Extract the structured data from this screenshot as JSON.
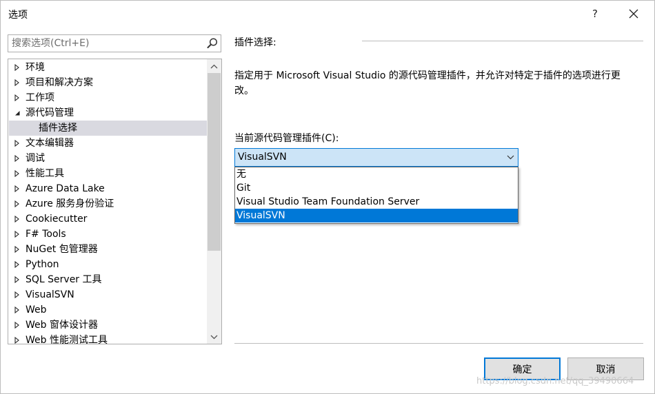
{
  "window": {
    "title": "选项",
    "help_label": "?"
  },
  "search": {
    "placeholder": "搜索选项(Ctrl+E)"
  },
  "tree": {
    "items": [
      {
        "label": "环境",
        "expanded": false
      },
      {
        "label": "项目和解决方案",
        "expanded": false
      },
      {
        "label": "工作项",
        "expanded": false
      },
      {
        "label": "源代码管理",
        "expanded": true
      },
      {
        "label": "插件选择",
        "child": true,
        "selected": true
      },
      {
        "label": "文本编辑器",
        "expanded": false
      },
      {
        "label": "调试",
        "expanded": false
      },
      {
        "label": "性能工具",
        "expanded": false
      },
      {
        "label": "Azure Data Lake",
        "expanded": false
      },
      {
        "label": "Azure 服务身份验证",
        "expanded": false
      },
      {
        "label": "Cookiecutter",
        "expanded": false
      },
      {
        "label": "F# Tools",
        "expanded": false
      },
      {
        "label": "NuGet 包管理器",
        "expanded": false
      },
      {
        "label": "Python",
        "expanded": false
      },
      {
        "label": "SQL Server 工具",
        "expanded": false
      },
      {
        "label": "VisualSVN",
        "expanded": false
      },
      {
        "label": "Web",
        "expanded": false
      },
      {
        "label": "Web 窗体设计器",
        "expanded": false
      },
      {
        "label": "Web 性能测试工具",
        "expanded": false
      }
    ]
  },
  "panel": {
    "heading": "插件选择:",
    "description": "指定用于 Microsoft Visual Studio 的源代码管理插件，并允许对特定于插件的选项进行更改。",
    "combo_label": "当前源代码管理插件(C):",
    "combo_value": "VisualSVN",
    "options": [
      "无",
      "Git",
      "Visual Studio Team Foundation Server",
      "VisualSVN"
    ],
    "highlighted_option": "VisualSVN"
  },
  "buttons": {
    "ok": "确定",
    "cancel": "取消"
  },
  "watermark": "https://blog.csdn.net/qq_39490664",
  "colors": {
    "accent": "#0078d7",
    "combo_bg": "#cce4f7",
    "selected_tree_bg": "#d9d9e0"
  }
}
